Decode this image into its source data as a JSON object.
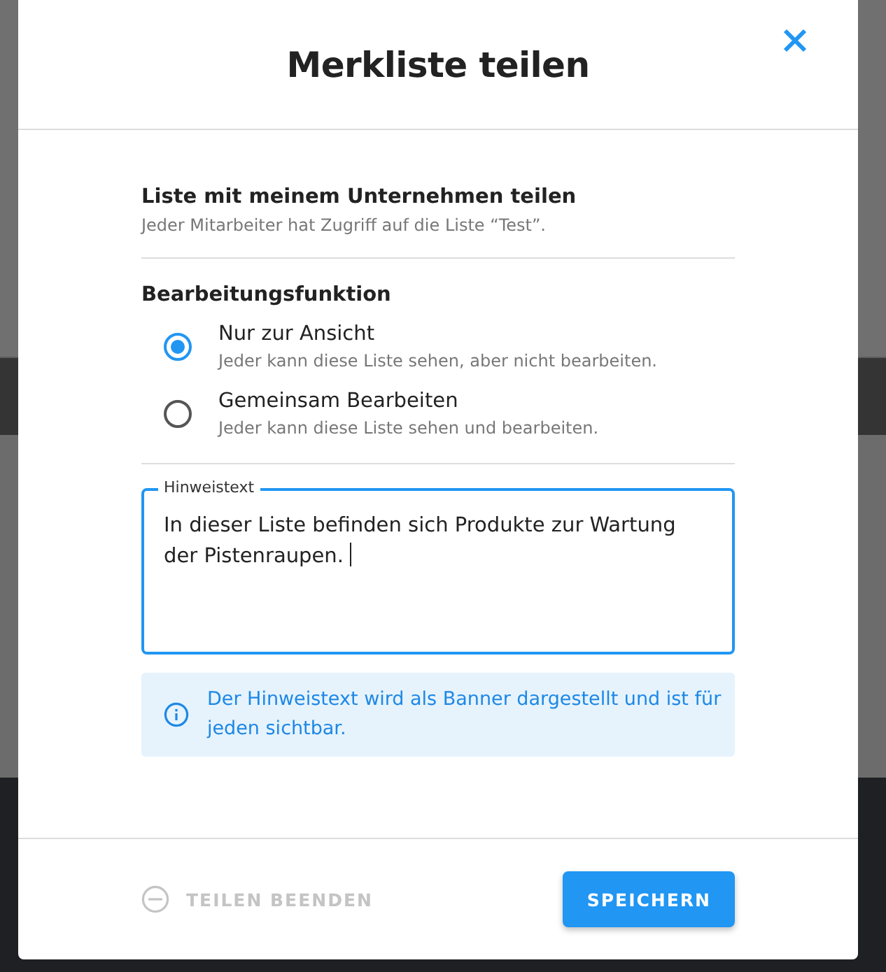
{
  "dialog": {
    "title": "Merkliste teilen"
  },
  "company_share": {
    "title": "Liste mit meinem Unternehmen teilen",
    "description": "Jeder Mitarbeiter hat Zugriff auf die Liste “Test”."
  },
  "edit_mode": {
    "title": "Bearbeitungsfunktion",
    "options": [
      {
        "label": "Nur zur Ansicht",
        "description": "Jeder kann diese Liste sehen, aber nicht bearbeiten.",
        "selected": true
      },
      {
        "label": "Gemeinsam Bearbeiten",
        "description": "Jeder kann diese Liste sehen und bearbeiten.",
        "selected": false
      }
    ]
  },
  "note_field": {
    "label": "Hinweistext",
    "value": "In dieser Liste befinden sich Produkte zur Wartung der Pistenraupen. "
  },
  "info_banner": {
    "text": "Der Hinweistext wird als Banner dargestellt und ist für jeden sichtbar."
  },
  "footer": {
    "buttons": [
      {
        "label": "TEILEN BEENDEN",
        "kind": "text",
        "disabled": true
      },
      {
        "label": "SPEICHERN",
        "kind": "primary",
        "disabled": false
      }
    ]
  }
}
